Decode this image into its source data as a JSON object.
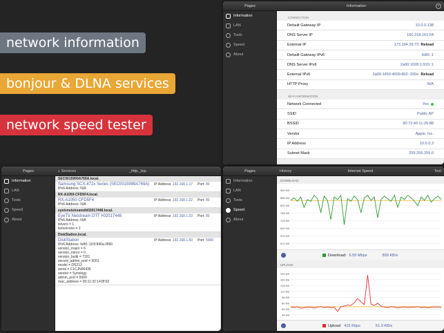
{
  "banners": [
    {
      "text": "network information",
      "color": "#6e7682"
    },
    {
      "text": "bonjour & DLNA services",
      "color": "#e9a735"
    },
    {
      "text": "network speed tester",
      "color": "#d7333d"
    }
  ],
  "sidebar_items": [
    "Information",
    "LAN",
    "Tools",
    "Speed",
    "About"
  ],
  "info_panel": {
    "sidebar_title": "Pages",
    "title": "Information",
    "connection_header": "CONNECTION",
    "connection_rows": [
      {
        "label": "Default Gateway IP",
        "value": "10.0.0.138",
        "action": ""
      },
      {
        "label": "DNS Server IP",
        "value": "160.218.161.54",
        "action": ""
      },
      {
        "label": "External IP",
        "value": "173.194.39.73",
        "action": "Reload"
      },
      {
        "label": "Default Gateway IPv6",
        "value": "fe80::1",
        "action": ""
      },
      {
        "label": "DNS Server IPv6",
        "value": "2a00:1028:1:910::1",
        "action": ""
      },
      {
        "label": "External IPv6",
        "value": "2a00:1450:4009:802::200e",
        "action": "Reload"
      },
      {
        "label": "HTTP Proxy",
        "value": "N/A",
        "action": ""
      }
    ],
    "wifi_header": "WI-FI INFORMATION",
    "wifi_rows": [
      {
        "label": "Network Connected",
        "value": "Yes",
        "dot": true
      },
      {
        "label": "SSID",
        "value": "Public AP"
      },
      {
        "label": "BSSID",
        "value": "90:72:40:1c:26:88"
      },
      {
        "label": "Vendor",
        "value": "Apple, Inc."
      },
      {
        "label": "IP Address",
        "value": "10.0.0.3"
      },
      {
        "label": "Subnet Mask",
        "value": "255.255.255.0"
      }
    ]
  },
  "services_panel": {
    "sidebar_title": "Pages",
    "back_label": "Services",
    "title": "_http._tcp.",
    "groups": [
      {
        "header": "SEC0015999A769A.local.",
        "name": "Samsung SCX-472x Series (SEC0015999A769A)",
        "lines": [
          "IPv6 Address: N/A"
        ],
        "ip_label": "IP Address:",
        "ip": "192.168.1.17",
        "port_label": "Port:",
        "port": "80"
      },
      {
        "header": "RX-A1050-CFD5F4.local.",
        "name": "RX-A1050 CFD5F4",
        "lines": [
          "IPv6 Address: N/A"
        ],
        "ip_label": "IP Address:",
        "ip": "192.168.1.22",
        "port_label": "Port:",
        "port": "80"
      },
      {
        "header": "eyetvnetstreamdtt02017448.local.",
        "name": "EyeTV Netstream DTT #02017448",
        "lines": [
          "IPv6 Address: N/A",
          "txtvers = 1",
          "tsmversion = 2"
        ],
        "ip_label": "IP Address:",
        "ip": "192.168.1.23",
        "port_label": "Port:",
        "port": "80"
      },
      {
        "header": "DiskStation.local.",
        "name": "DiskStation",
        "lines": [
          "IPv6 Address: fe80::11f3:840a:2860",
          "version_major = 6",
          "version_minor = 0",
          "version_build = 7321",
          "secure_admin_port = 5001",
          "model = DS213",
          "serial = C1CJN06436",
          "vendor = Synology",
          "admin_port = 5000",
          "mac_address = 00:11:32:14:8f:92"
        ],
        "ip_label": "IP Address:",
        "ip": "192.168.1.50",
        "port_label": "Port:",
        "port": "5000"
      }
    ]
  },
  "speed_panel": {
    "sidebar_title": "Pages",
    "history_label": "History",
    "title": "Internet Speed",
    "test_label": "Test",
    "download_header": "DOWNLOAD",
    "upload_header": "UPLOAD",
    "download_status_label": "Download:",
    "download_mbps": "6.55 Mbps",
    "download_kbs": "839 KB/s",
    "upload_status_label": "Upload:",
    "upload_kbps": "415 Kbps",
    "upload_kbs": "51.9 KB/s",
    "download_color": "#2f9a2f",
    "upload_color": "#e03030",
    "avg_color": "#f0b030"
  },
  "chart_data": [
    {
      "type": "line",
      "title": "DOWNLOAD",
      "ylim": [
        300,
        1000
      ],
      "y_ticks": [
        "960 KB",
        "896 KB",
        "832 KB",
        "768 KB",
        "704 KB",
        "640 KB",
        "576 KB",
        "512 KB"
      ],
      "average": 839,
      "series": [
        {
          "values": [
            840,
            870,
            830,
            880,
            760,
            850,
            830,
            900,
            860,
            700,
            890,
            840,
            620,
            880,
            850,
            900,
            560,
            860,
            830,
            890,
            850,
            700,
            870,
            900,
            840,
            880,
            640,
            850,
            890,
            860,
            830,
            900,
            760,
            880,
            850,
            900,
            870,
            830,
            780,
            880,
            840,
            900,
            820,
            860,
            890,
            850
          ]
        }
      ]
    },
    {
      "type": "line",
      "title": "UPLOAD",
      "ylim": [
        0,
        220
      ],
      "y_ticks": [
        "192 KB",
        "160 KB",
        "128 KB",
        "112 KB",
        "96 KB",
        "80 KB",
        "64 KB",
        "48 KB"
      ],
      "average": 51.9,
      "series": [
        {
          "values": [
            50,
            48,
            52,
            45,
            47,
            50,
            49,
            46,
            50,
            52,
            48,
            50,
            47,
            49,
            30,
            52,
            55,
            60,
            58,
            70,
            90,
            75,
            62,
            200,
            65,
            58,
            68,
            55,
            50,
            48,
            52,
            50,
            47,
            49,
            51,
            48,
            50,
            49,
            52,
            48,
            50,
            47,
            49,
            51,
            50,
            48
          ]
        }
      ]
    }
  ]
}
